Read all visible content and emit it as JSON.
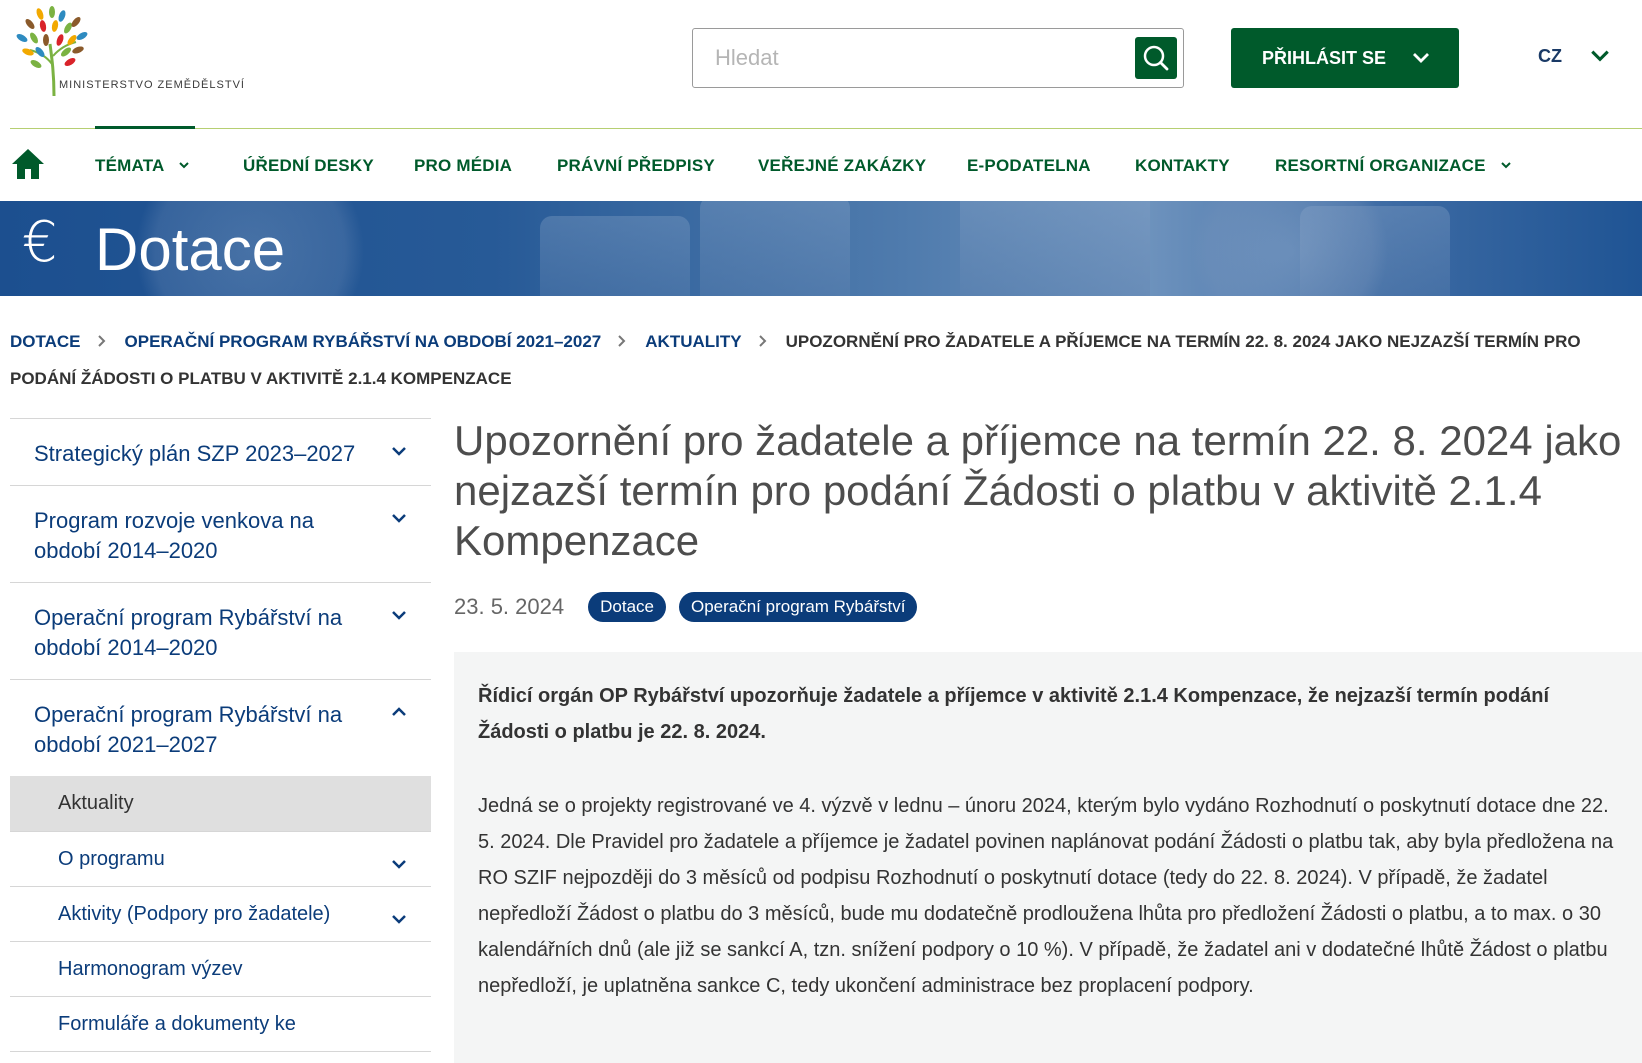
{
  "header": {
    "logo_text": "MINISTERSTVO ZEMĚDĚLSTVÍ",
    "search_placeholder": "Hledat",
    "login_label": "PŘIHLÁSIT SE",
    "language": "CZ"
  },
  "nav": {
    "items": [
      {
        "label": "TÉMATA"
      },
      {
        "label": "ÚŘEDNÍ DESKY"
      },
      {
        "label": "PRO MÉDIA"
      },
      {
        "label": "PRÁVNÍ PŘEDPISY"
      },
      {
        "label": "VEŘEJNÉ ZAKÁZKY"
      },
      {
        "label": "E-PODATELNA"
      },
      {
        "label": "KONTAKTY"
      },
      {
        "label": "RESORTNÍ ORGANIZACE"
      }
    ]
  },
  "banner": {
    "symbol": "€",
    "title": "Dotace"
  },
  "breadcrumb": {
    "items": [
      "DOTACE",
      "OPERAČNÍ PROGRAM RYBÁŘSTVÍ NA OBDOBÍ 2021–2027",
      "AKTUALITY"
    ],
    "current": "UPOZORNĚNÍ PRO ŽADATELE A PŘÍJEMCE NA TERMÍN 22. 8. 2024 JAKO NEJZAZŠÍ TERMÍN PRO PODÁNÍ ŽÁDOSTI O PLATBU V AKTIVITĚ 2.1.4 KOMPENZACE"
  },
  "sidebar": {
    "sections": [
      {
        "label": "Strategický plán SZP 2023–2027"
      },
      {
        "label": "Program rozvoje venkova na období 2014–2020"
      },
      {
        "label": "Operační program Rybářství na období 2014–2020"
      },
      {
        "label": "Operační program Rybářství na období 2021–2027"
      }
    ],
    "sub_items": [
      {
        "label": "Aktuality"
      },
      {
        "label": "O programu"
      },
      {
        "label": "Aktivity (Podpory pro žadatele)"
      },
      {
        "label": "Harmonogram výzev"
      },
      {
        "label": "Formuláře a dokumenty ke stažení"
      }
    ]
  },
  "article": {
    "title": "Upozornění pro žadatele a příjemce na termín 22. 8. 2024 jako nejzazší termín pro podání Žádosti o platbu v aktivitě 2.1.4 Kompenzace",
    "date": "23. 5. 2024",
    "tags": [
      "Dotace",
      "Operační program Rybářství"
    ],
    "lead": "Řídicí orgán OP Rybářství upozorňuje žadatele a příjemce v aktivitě 2.1.4 Kompenzace, že nejzazší termín podání Žádosti o platbu je 22. 8. 2024.",
    "body": "Jedná se o projekty registrované ve 4. výzvě v lednu – únoru 2024, kterým bylo vydáno Rozhodnutí o poskytnutí dotace dne 22. 5. 2024. Dle Pravidel pro žadatele a příjemce je žadatel povinen naplánovat podání Žádosti o platbu tak, aby byla předložena na RO SZIF nejpozději do 3 měsíců od podpisu Rozhodnutí o poskytnutí dotace (tedy do 22. 8. 2024). V případě, že žadatel nepředloží Žádost o platbu do 3 měsíců, bude mu dodatečně prodloužena lhůta pro předložení Žádosti o platbu, a to max. o 30 kalendářních dnů (ale již se sankcí A, tzn. snížení podpory o 10 %). V případě, že žadatel ani v dodatečné lhůtě Žádost o platbu nepředloží, je uplatněna sankce C, tedy ukončení administrace bez proplacení podpory."
  },
  "colors": {
    "brand_green": "#005a2b",
    "link_blue": "#0b3c7a",
    "nav_line": "#b6cf72"
  }
}
